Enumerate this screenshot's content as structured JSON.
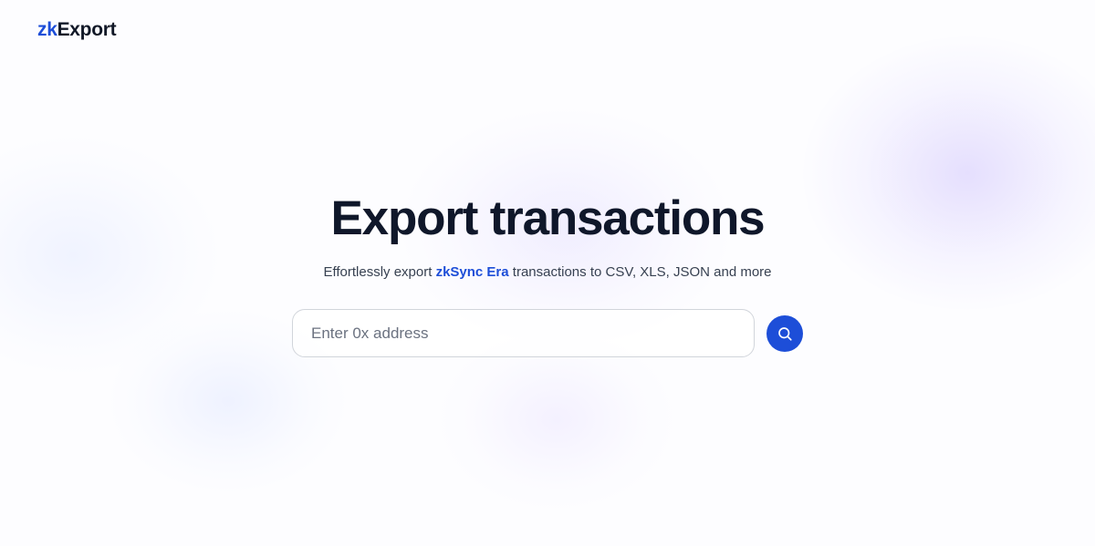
{
  "brand": {
    "logo_prefix": "zk",
    "logo_suffix": "Export"
  },
  "hero": {
    "title": "Export transactions",
    "subtitle_before": "Effortlessly export ",
    "subtitle_highlight": "zkSync Era",
    "subtitle_after": " transactions to CSV, XLS, JSON and more"
  },
  "search": {
    "value": "",
    "placeholder": "Enter 0x address",
    "button_icon": "search-icon"
  },
  "colors": {
    "accent": "#1d4ed8",
    "heading": "#0f172a",
    "body_text": "#374151",
    "placeholder": "#6b7280"
  }
}
